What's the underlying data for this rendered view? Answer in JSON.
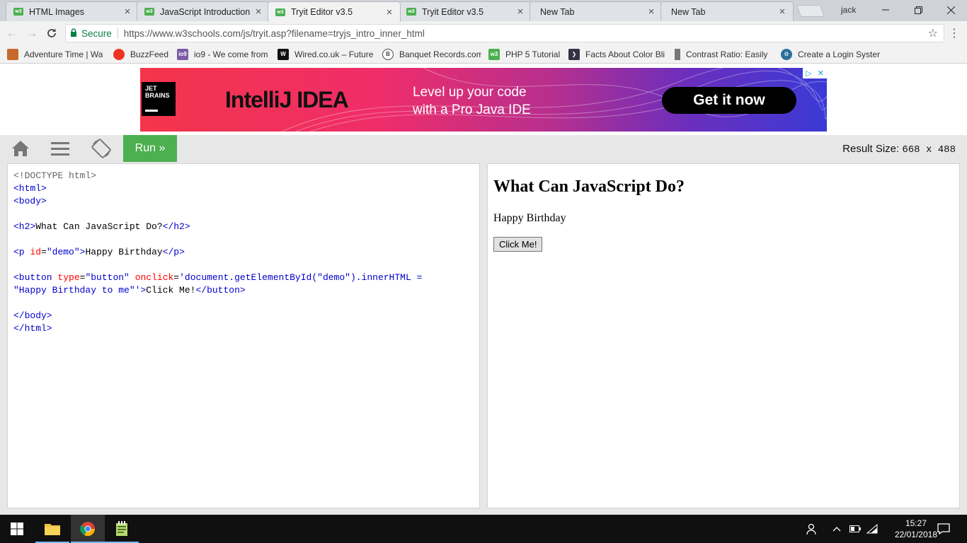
{
  "browser": {
    "tabs": [
      {
        "title": "HTML Images",
        "icon": "w3schools-icon",
        "active": false
      },
      {
        "title": "JavaScript Introduction",
        "icon": "w3schools-icon",
        "active": false
      },
      {
        "title": "Tryit Editor v3.5",
        "icon": "w3schools-icon",
        "active": true
      },
      {
        "title": "Tryit Editor v3.5",
        "icon": "w3schools-icon",
        "active": false
      },
      {
        "title": "New Tab",
        "icon": "none",
        "active": false
      },
      {
        "title": "New Tab",
        "icon": "none",
        "active": false
      }
    ],
    "profile_name": "jack",
    "secure_label": "Secure",
    "url": "https://www.w3schools.com/js/tryit.asp?filename=tryjs_intro_inner_html",
    "bookmarks": [
      {
        "label": "Adventure Time | Wa",
        "color": "#c56a2c"
      },
      {
        "label": "BuzzFeed",
        "color": "#e32"
      },
      {
        "label": "io9 - We come from t",
        "color": "#7a5ca3"
      },
      {
        "label": "Wired.co.uk – Future",
        "color": "#111"
      },
      {
        "label": "Banquet Records.com",
        "color": "#444"
      },
      {
        "label": "PHP 5 Tutorial",
        "color": "#4CAF50"
      },
      {
        "label": "Facts About Color Bli",
        "color": "#334"
      },
      {
        "label": "Contrast Ratio: Easily",
        "color": "#777"
      },
      {
        "label": "Create a Login Syster",
        "color": "#2c6e9e"
      }
    ]
  },
  "ad": {
    "logo_text": "JET BRAINS",
    "product": "IntelliJ IDEA",
    "tagline_1": "Level up your code",
    "tagline_2": "with a Pro Java IDE",
    "cta": "Get it now"
  },
  "tryit": {
    "run_label": "Run »",
    "result_size_label": "Result Size:",
    "result_size_value": "668 x 488"
  },
  "code": {
    "doctype": "<!DOCTYPE html>",
    "html_open": "<html>",
    "body_open": "<body>",
    "h2_open": "<h2>",
    "h2_text": "What Can JavaScript Do?",
    "h2_close": "</h2>",
    "p_open": "<p",
    "p_attr": "id",
    "p_val": "\"demo\"",
    "p_text": "Happy Birthday",
    "p_close": "</p>",
    "btn_open": "<button",
    "btn_attr1": "type",
    "btn_val1": "\"button\"",
    "btn_attr2": "onclick",
    "btn_val2a": "'document.getElementById(\"demo\").innerHTML =",
    "btn_val2b": "\"Happy Birthday to me\"'",
    "btn_text": "Click Me!",
    "btn_close": "</button>",
    "body_close": "</body>",
    "html_close": "</html>"
  },
  "result": {
    "heading": "What Can JavaScript Do?",
    "paragraph": "Happy Birthday",
    "button": "Click Me!"
  },
  "taskbar": {
    "time": "15:27",
    "date": "22/01/2018"
  },
  "colors": {
    "run_green": "#4CAF50",
    "code_tag": "mediumblue",
    "code_attr": "red"
  }
}
